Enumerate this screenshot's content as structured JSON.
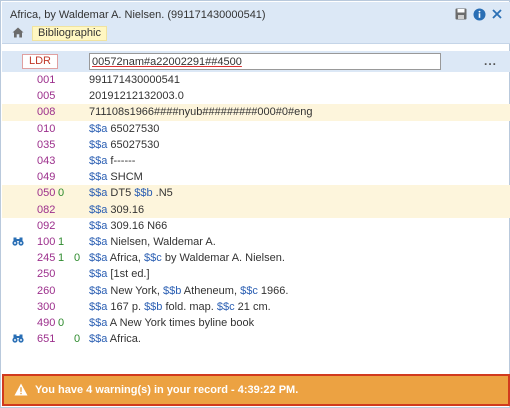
{
  "window": {
    "title": "Africa, by Waldemar A. Nielsen. (991171430000541)",
    "tag_label": "Bibliographic",
    "icons": [
      "save-icon",
      "info-icon",
      "close-icon",
      "home-icon"
    ],
    "colors": {
      "header": "#dce8f6",
      "warning_bg": "#eca242",
      "warning_border": "#d13a1e",
      "tag_color": "#9c2f8c",
      "subfield_color": "#2b5fb3",
      "indicator_color": "#2e8b2e"
    }
  },
  "ldr": {
    "label": "LDR",
    "value": "00572nam#a22002291##4500",
    "more": "..."
  },
  "fields": [
    {
      "tag": "001",
      "ind1": "",
      "ind2": "",
      "parts": [
        {
          "t": "991171430000541"
        }
      ],
      "hl": false,
      "bino": false
    },
    {
      "tag": "005",
      "ind1": "",
      "ind2": "",
      "parts": [
        {
          "t": "20191212132003.0"
        }
      ],
      "hl": false,
      "bino": false
    },
    {
      "tag": "008",
      "ind1": "",
      "ind2": "",
      "parts": [
        {
          "t": "711108s1966####nyub#########000#0#eng"
        }
      ],
      "hl": true,
      "bino": false
    },
    {
      "tag": "010",
      "ind1": "",
      "ind2": "",
      "parts": [
        {
          "s": "$$a"
        },
        {
          "t": " 65027530"
        }
      ],
      "hl": false,
      "bino": false
    },
    {
      "tag": "035",
      "ind1": "",
      "ind2": "",
      "parts": [
        {
          "s": "$$a"
        },
        {
          "t": " 65027530"
        }
      ],
      "hl": false,
      "bino": false
    },
    {
      "tag": "043",
      "ind1": "",
      "ind2": "",
      "parts": [
        {
          "s": "$$a"
        },
        {
          "t": " f------"
        }
      ],
      "hl": false,
      "bino": false
    },
    {
      "tag": "049",
      "ind1": "",
      "ind2": "",
      "parts": [
        {
          "s": "$$a"
        },
        {
          "t": " SHCM"
        }
      ],
      "hl": false,
      "bino": false
    },
    {
      "tag": "050",
      "ind1": "0",
      "ind2": "",
      "parts": [
        {
          "s": "$$a"
        },
        {
          "t": " DT5 "
        },
        {
          "s": "$$b"
        },
        {
          "t": " .N5"
        }
      ],
      "hl": true,
      "bino": false
    },
    {
      "tag": "082",
      "ind1": "",
      "ind2": "",
      "parts": [
        {
          "s": "$$a"
        },
        {
          "t": " 309.16"
        }
      ],
      "hl": true,
      "bino": false
    },
    {
      "tag": "092",
      "ind1": "",
      "ind2": "",
      "parts": [
        {
          "s": "$$a"
        },
        {
          "t": " 309.16 N66"
        }
      ],
      "hl": false,
      "bino": false
    },
    {
      "tag": "100",
      "ind1": "1",
      "ind2": "",
      "parts": [
        {
          "s": "$$a"
        },
        {
          "t": " Nielsen, Waldemar A."
        }
      ],
      "hl": false,
      "bino": true
    },
    {
      "tag": "245",
      "ind1": "1",
      "ind2": "0",
      "parts": [
        {
          "s": "$$a"
        },
        {
          "t": " Africa, "
        },
        {
          "s": "$$c"
        },
        {
          "t": " by Waldemar A. Nielsen."
        }
      ],
      "hl": false,
      "bino": false
    },
    {
      "tag": "250",
      "ind1": "",
      "ind2": "",
      "parts": [
        {
          "s": "$$a"
        },
        {
          "t": " [1st ed.]"
        }
      ],
      "hl": false,
      "bino": false
    },
    {
      "tag": "260",
      "ind1": "",
      "ind2": "",
      "parts": [
        {
          "s": "$$a"
        },
        {
          "t": " New York, "
        },
        {
          "s": "$$b"
        },
        {
          "t": " Atheneum, "
        },
        {
          "s": "$$c"
        },
        {
          "t": " 1966."
        }
      ],
      "hl": false,
      "bino": false
    },
    {
      "tag": "300",
      "ind1": "",
      "ind2": "",
      "parts": [
        {
          "s": "$$a"
        },
        {
          "t": " 167 p. "
        },
        {
          "s": "$$b"
        },
        {
          "t": " fold. map. "
        },
        {
          "s": "$$c"
        },
        {
          "t": " 21 cm."
        }
      ],
      "hl": false,
      "bino": false
    },
    {
      "tag": "490",
      "ind1": "0",
      "ind2": "",
      "parts": [
        {
          "s": "$$a"
        },
        {
          "t": " A New York times byline book"
        }
      ],
      "hl": false,
      "bino": false
    },
    {
      "tag": "651",
      "ind1": "",
      "ind2": "0",
      "parts": [
        {
          "s": "$$a"
        },
        {
          "t": " Africa."
        }
      ],
      "hl": false,
      "bino": true
    }
  ],
  "warning": {
    "text": "You have 4 warning(s) in your record - 4:39:22 PM.",
    "icon": "warning-triangle-icon"
  }
}
